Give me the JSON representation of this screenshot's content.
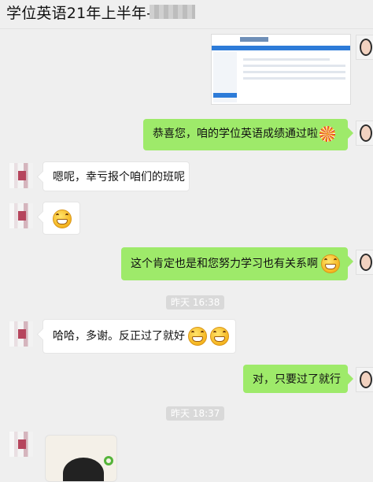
{
  "header": {
    "title": "学位英语21年上半年-"
  },
  "colors": {
    "out_bubble": "#9eea6a",
    "in_bubble": "#ffffff",
    "background": "#efefef"
  },
  "messages": [
    {
      "side": "right",
      "kind": "image",
      "content": "screenshot"
    },
    {
      "side": "right",
      "text": "恭喜您，咱的学位英语成绩通过啦",
      "icon": "firework-icon"
    },
    {
      "side": "left",
      "text": "嗯呢，幸亏报个咱们的班呢"
    },
    {
      "side": "left",
      "kind": "emoji",
      "icon": "laugh-cry-emoji"
    },
    {
      "side": "right",
      "text": "这个肯定也是和您努力学习也有关系啊",
      "icon": "grin-emoji"
    },
    {
      "kind": "time",
      "text": "昨天 16:38"
    },
    {
      "side": "left",
      "text": "哈哈，多谢。反正过了就好",
      "icons": [
        "grin-emoji",
        "grin-emoji"
      ]
    },
    {
      "side": "right",
      "text": "对，只要过了就行"
    },
    {
      "kind": "time",
      "text": "昨天 18:37"
    },
    {
      "side": "left",
      "kind": "image",
      "content": "photo"
    }
  ]
}
